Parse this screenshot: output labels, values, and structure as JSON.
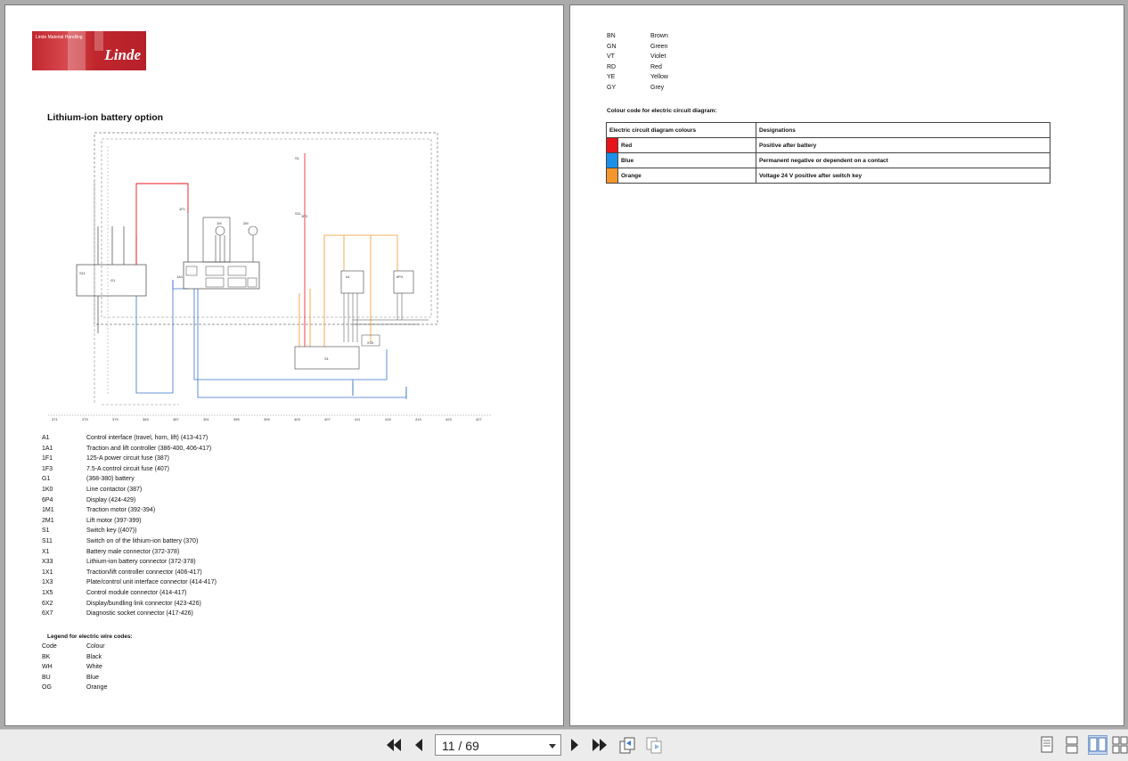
{
  "viewer": {
    "page_indicator": "11 / 69"
  },
  "left_page": {
    "logo_subtext": "Linde Material Handling",
    "logo_brand": "Linde",
    "title": "Lithium-ion battery option",
    "components": [
      {
        "code": "A1",
        "desc": "Control interface (travel, horn, lift) (413-417)"
      },
      {
        "code": "1A1",
        "desc": "Traction and lift controller (386-400, 406-417)"
      },
      {
        "code": "1F1",
        "desc": "125-A power circuit fuse (387)"
      },
      {
        "code": "1F3",
        "desc": "7.5-A control circuit fuse (407)"
      },
      {
        "code": "G1",
        "desc": "(368-380) battery"
      },
      {
        "code": "1K0",
        "desc": "Line contactor (387)"
      },
      {
        "code": "6P4",
        "desc": "Display (424-429)"
      },
      {
        "code": "1M1",
        "desc": "Traction motor (392-394)"
      },
      {
        "code": "2M1",
        "desc": "Lift motor (397-399)"
      },
      {
        "code": "S1",
        "desc": "Switch key ((407))"
      },
      {
        "code": "S11",
        "desc": "Switch on of the lithium-ion battery (370)"
      },
      {
        "code": "X1",
        "desc": "Battery male connector (372-378)"
      },
      {
        "code": "X33",
        "desc": "Lithium-ion battery connector (372-378)"
      },
      {
        "code": "1X1",
        "desc": "Traction/lift controller connector (406-417)"
      },
      {
        "code": "1X3",
        "desc": "Plate/control unit interface connector (414-417)"
      },
      {
        "code": "1X5",
        "desc": "Control module connector (414-417)"
      },
      {
        "code": "6X2",
        "desc": "Display/bundling link connector (423-426)"
      },
      {
        "code": "6X7",
        "desc": "Diagnostic socket connector (417-426)"
      }
    ],
    "legend_title": "Legend for electric wire codes:",
    "legend_header": {
      "code": "Code",
      "colour": "Colour"
    },
    "legend": [
      {
        "code": "BK",
        "colour": "Black"
      },
      {
        "code": "WH",
        "colour": "White"
      },
      {
        "code": "BU",
        "colour": "Blue"
      },
      {
        "code": "OG",
        "colour": "Orange"
      }
    ],
    "diagram_labels": {
      "g1": "G1",
      "a1": "A1",
      "a1_top": "1A1",
      "m1": "1M",
      "m2": "2M",
      "p6": "6P4",
      "f1": "1F1",
      "s11": "S11",
      "s1": "S1",
      "f3": "1F3",
      "x33": "X33",
      "s1b": "S1"
    },
    "ruler_marks": [
      "371",
      "375",
      "379",
      "383",
      "387",
      "391",
      "395",
      "399",
      "403",
      "407",
      "411",
      "415",
      "419",
      "423",
      "427"
    ]
  },
  "right_page": {
    "colors": [
      {
        "code": "BN",
        "name": "Brown"
      },
      {
        "code": "GN",
        "name": "Green"
      },
      {
        "code": "VT",
        "name": "Violet"
      },
      {
        "code": "RD",
        "name": "Red"
      },
      {
        "code": "YE",
        "name": "Yellow"
      },
      {
        "code": "GY",
        "name": "Grey"
      }
    ],
    "colour_code_title": "Colour code for electric circuit diagram:",
    "table_header": {
      "col1": "Electric circuit diagram colours",
      "col2": "Designations"
    },
    "table_rows": [
      {
        "swatch": "#e8141b",
        "colour": "Red",
        "designation": "Positive after battery"
      },
      {
        "swatch": "#1c8fe8",
        "colour": "Blue",
        "designation": "Permanent negative or dependent on a contact"
      },
      {
        "swatch": "#f5962b",
        "colour": "Orange",
        "designation": "Voltage 24 V positive after switch key"
      }
    ]
  }
}
